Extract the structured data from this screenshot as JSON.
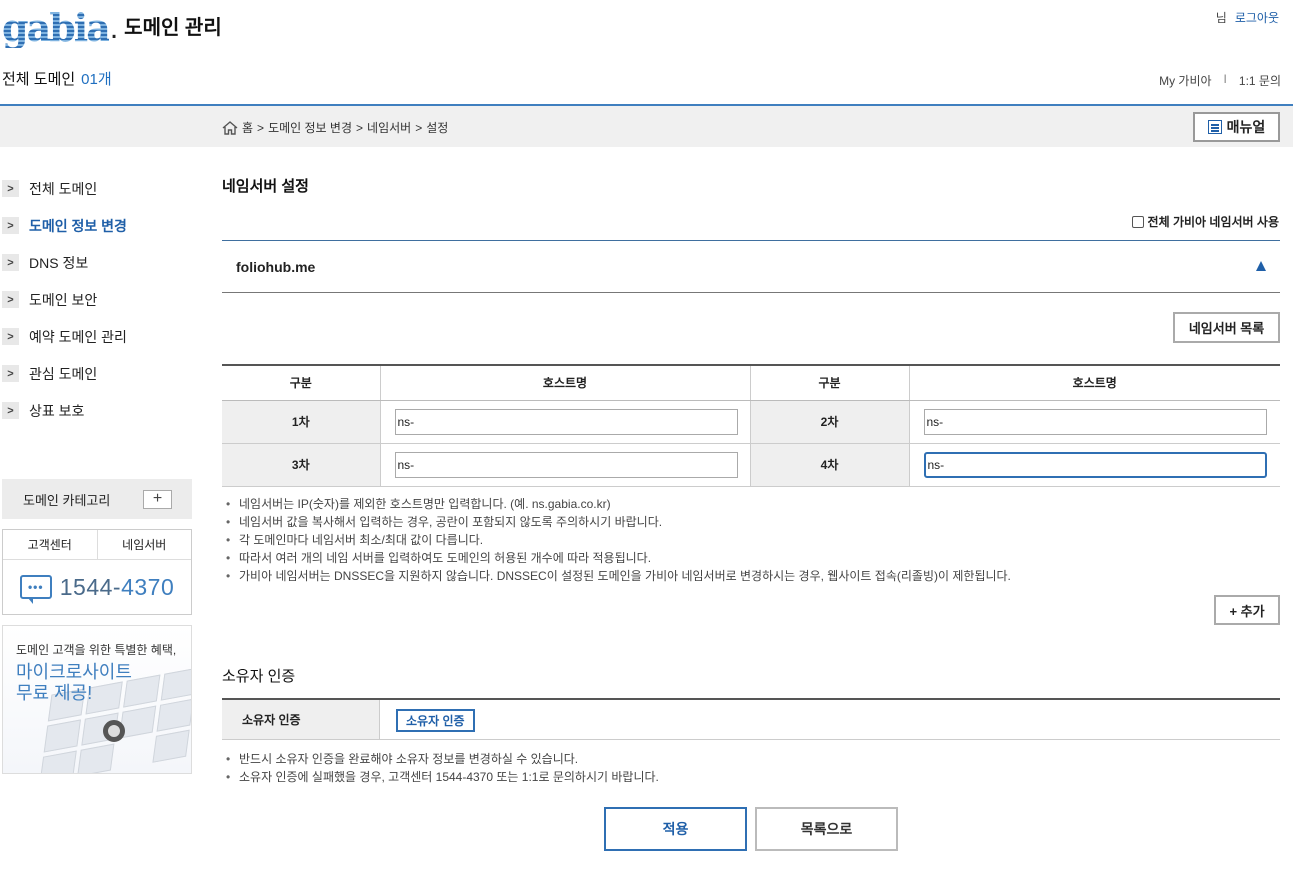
{
  "header": {
    "logo_text": "gabia",
    "logo_dot": ".",
    "title": "도메인 관리",
    "user_suffix": "님",
    "logout": "로그아웃",
    "total_label": "전체 도메인",
    "total_count": "01개",
    "links": {
      "my": "My 가비아",
      "separator": "I",
      "inquiry": "1:1 문의"
    }
  },
  "breadcrumb": [
    "홈",
    ">",
    "도메인 정보 변경",
    ">",
    "네임서버",
    ">",
    "설정"
  ],
  "manual_label": "매뉴얼",
  "sidebar": {
    "arrow": ">",
    "items": [
      {
        "label": "전체 도메인",
        "active": false
      },
      {
        "label": "도메인 정보 변경",
        "active": true
      },
      {
        "label": "DNS 정보",
        "active": false
      },
      {
        "label": "도메인 보안",
        "active": false
      },
      {
        "label": "예약 도메인 관리",
        "active": false
      },
      {
        "label": "관심 도메인",
        "active": false
      },
      {
        "label": "상표 보호",
        "active": false
      }
    ],
    "category_label": "도메인 카테고리",
    "category_plus": "+",
    "support_tabs": [
      "고객센터",
      "네임서버"
    ],
    "chat_glyph": "•••",
    "phone_prefix": "1544-",
    "phone_suffix": "4370",
    "banner_small": "도메인 고객을 위한 특별한 혜택,",
    "banner_big_1": "마이크로사이트",
    "banner_big_2": "무료 제공!"
  },
  "main": {
    "section_title": "네임서버 설정",
    "all_gabia_ns": "전체 가비아 네임서버 사용",
    "domain": "foliohub.me",
    "ns_list_button": "네임서버 목록",
    "table": {
      "headers": [
        "구분",
        "호스트명",
        "구분",
        "호스트명"
      ],
      "rows": [
        {
          "label_a": "1차",
          "value_a": "ns-",
          "label_b": "2차",
          "value_b": "ns-"
        },
        {
          "label_a": "3차",
          "value_a": "ns-",
          "label_b": "4차",
          "value_b": "ns-"
        }
      ]
    },
    "notes": [
      "네임서버는 IP(숫자)를 제외한 호스트명만 입력합니다. (예. ns.gabia.co.kr)",
      "네임서버 값을 복사해서 입력하는 경우, 공란이 포함되지 않도록 주의하시기 바랍니다.",
      "각 도메인마다 네임서버 최소/최대 값이 다릅니다.",
      "따라서 여러 개의 네임 서버를 입력하여도 도메인의 허용된 개수에 따라 적용됩니다.",
      "가비아 네임서버는 DNSSEC을 지원하지 않습니다. DNSSEC이 설정된 도메인을 가비아 네임서버로 변경하시는 경우, 웹사이트 접속(리졸빙)이 제한됩니다."
    ],
    "add_button": "+ 추가",
    "owner": {
      "title": "소유자 인증",
      "row_label": "소유자 인증",
      "button": "소유자 인증",
      "notes": [
        "반드시 소유자 인증을 완료해야 소유자 정보를 변경하실 수 있습니다.",
        "소유자 인증에 실패했을 경우, 고객센터 1544-4370 또는 1:1로 문의하시기 바랍니다."
      ]
    },
    "apply_button": "적용",
    "list_button": "목록으로"
  },
  "colors": {
    "accent": "#3f7fbf",
    "link": "#1f5fa8",
    "bar": "#f0f0f0"
  }
}
